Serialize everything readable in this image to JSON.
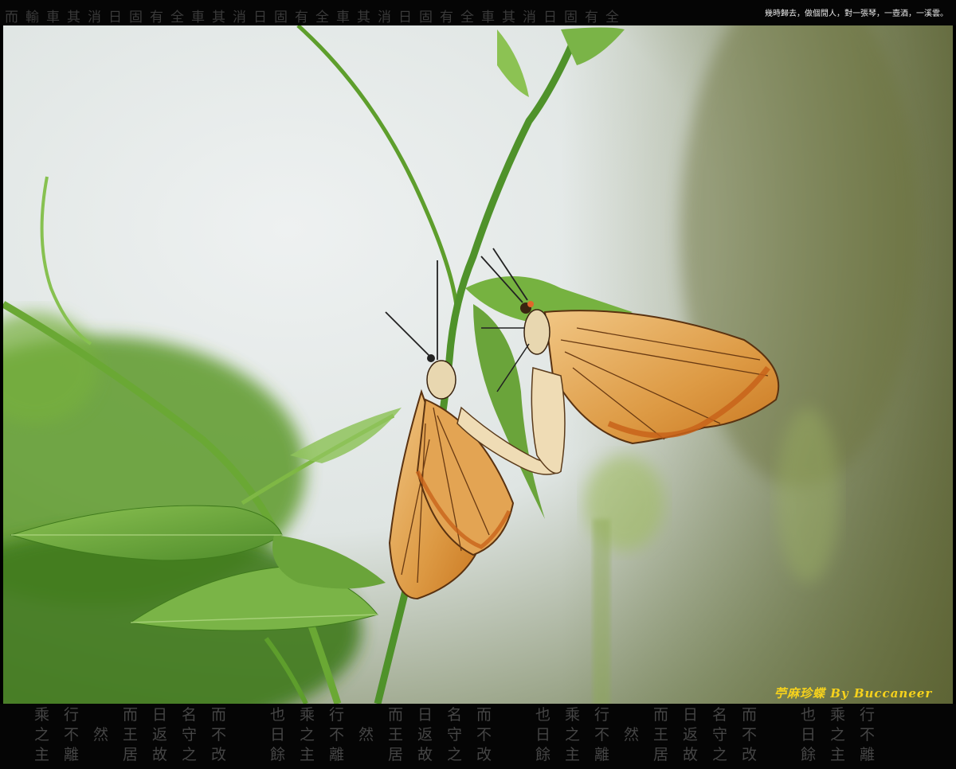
{
  "header": {
    "glyph_band": "而輸車其消日固有全車其消日固有全車其消日固有全車其消日固有全",
    "caption": "幾時歸去，做個閒人，對一張琴，一壺酒，一溪雲。"
  },
  "photo": {
    "subject": "butterflies",
    "signature": "苧麻珍蝶 By Buccaneer"
  },
  "footer": {
    "glyph_columns": [
      "乘\n之\n主",
      "行\n不\n離",
      "\n然",
      "而\n王\n居",
      "日\n返\n故",
      "名\n守\n之",
      "而\n不\n改",
      "",
      "也\n日\n餘",
      "乘\n之\n主",
      "行\n不\n離",
      "\n然",
      "而\n王\n居",
      "日\n返\n故",
      "名\n守\n之",
      "而\n不\n改",
      "",
      "也\n日\n餘",
      "乘\n之\n主",
      "行\n不\n離",
      "\n然",
      "而\n王\n居",
      "日\n返\n故",
      "名\n守\n之",
      "而\n不\n改",
      "",
      "也\n日\n餘",
      "乘\n之\n主",
      "行\n不\n離"
    ]
  },
  "colors": {
    "background": "#000000",
    "signature": "#f6d21c",
    "wing_orange": "#d98a2c",
    "leaf_green": "#6fae3a"
  }
}
